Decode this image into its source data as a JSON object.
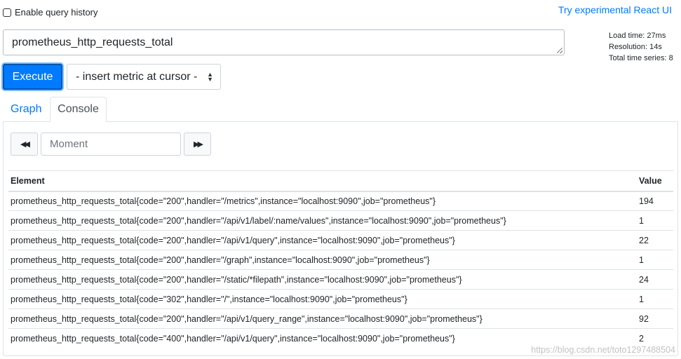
{
  "header": {
    "history_label": "Enable query history",
    "react_link": "Try experimental React UI"
  },
  "query": {
    "value": "prometheus_http_requests_total"
  },
  "stats": {
    "load_time": "Load time: 27ms",
    "resolution": "Resolution: 14s",
    "total_series": "Total time series: 8"
  },
  "actions": {
    "execute_label": "Execute",
    "metric_select_value": "- insert metric at cursor -"
  },
  "tabs": [
    {
      "label": "Graph",
      "active": false
    },
    {
      "label": "Console",
      "active": true
    }
  ],
  "console": {
    "moment_placeholder": "Moment",
    "back_icon": "backward-icon",
    "forward_icon": "forward-icon",
    "columns": [
      "Element",
      "Value"
    ],
    "rows": [
      {
        "element": "prometheus_http_requests_total{code=\"200\",handler=\"/metrics\",instance=\"localhost:9090\",job=\"prometheus\"}",
        "value": "194"
      },
      {
        "element": "prometheus_http_requests_total{code=\"200\",handler=\"/api/v1/label/:name/values\",instance=\"localhost:9090\",job=\"prometheus\"}",
        "value": "1"
      },
      {
        "element": "prometheus_http_requests_total{code=\"200\",handler=\"/api/v1/query\",instance=\"localhost:9090\",job=\"prometheus\"}",
        "value": "22"
      },
      {
        "element": "prometheus_http_requests_total{code=\"200\",handler=\"/graph\",instance=\"localhost:9090\",job=\"prometheus\"}",
        "value": "1"
      },
      {
        "element": "prometheus_http_requests_total{code=\"200\",handler=\"/static/*filepath\",instance=\"localhost:9090\",job=\"prometheus\"}",
        "value": "24"
      },
      {
        "element": "prometheus_http_requests_total{code=\"302\",handler=\"/\",instance=\"localhost:9090\",job=\"prometheus\"}",
        "value": "1"
      },
      {
        "element": "prometheus_http_requests_total{code=\"200\",handler=\"/api/v1/query_range\",instance=\"localhost:9090\",job=\"prometheus\"}",
        "value": "92"
      },
      {
        "element": "prometheus_http_requests_total{code=\"400\",handler=\"/api/v1/query\",instance=\"localhost:9090\",job=\"prometheus\"}",
        "value": "2"
      }
    ]
  },
  "watermark": "https://blog.csdn.net/toto1297488504",
  "colors": {
    "accent": "#007bff",
    "border": "#dee2e6"
  }
}
